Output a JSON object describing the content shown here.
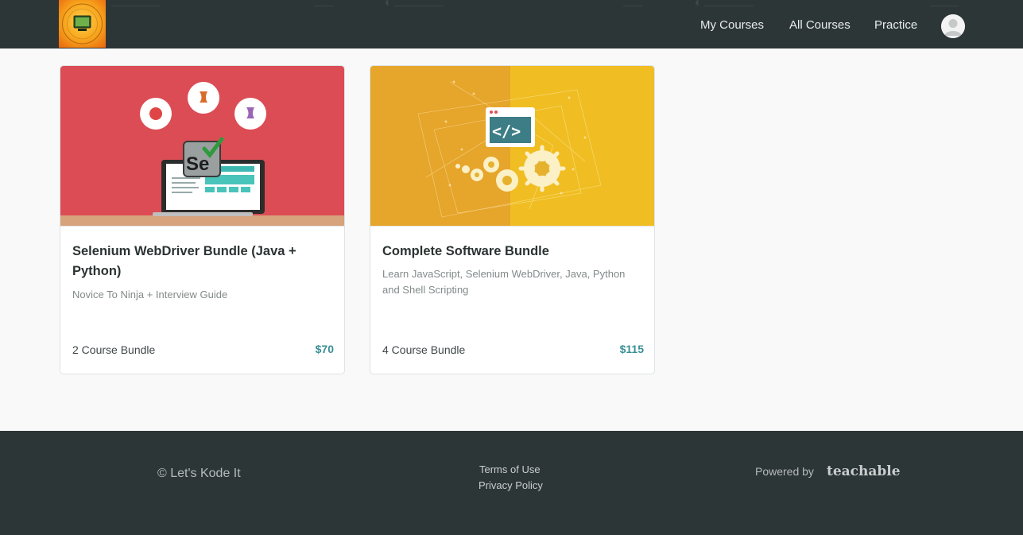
{
  "header": {
    "logo_alt": "Let's Kode It",
    "nav": [
      "My Courses",
      "All Courses",
      "Practice"
    ]
  },
  "courses": [
    {
      "title": "Selenium WebDriver Bundle (Java + Python)",
      "subtitle": "Novice To Ninja + Interview Guide",
      "bundle": "2 Course Bundle",
      "price": "$70",
      "banner_color": "#dc4c55"
    },
    {
      "title": "Complete Software Bundle",
      "subtitle": "Learn JavaScript, Selenium WebDriver, Java, Python and Shell Scripting",
      "bundle": "4 Course Bundle",
      "price": "$115",
      "banner_color": "#f0be23"
    }
  ],
  "footer": {
    "copyright": "© Let's Kode It",
    "links": [
      "Terms of Use",
      "Privacy Policy"
    ],
    "powered_by": "Powered by",
    "brand": "teachable"
  },
  "colors": {
    "header_bg": "#2d3637",
    "accent_price": "#3a8f95",
    "page_bg": "#f9f9f9"
  }
}
